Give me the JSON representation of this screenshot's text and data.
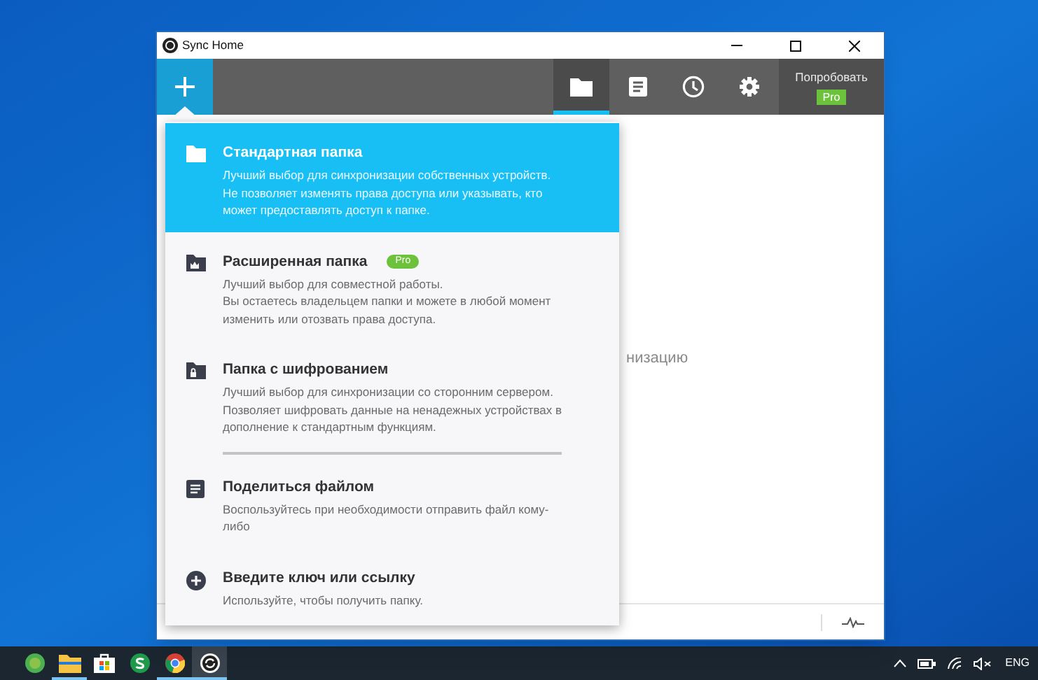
{
  "window": {
    "title": "Sync Home"
  },
  "toolbar": {
    "tabs": [
      {
        "kind": "folder",
        "selected": true
      },
      {
        "kind": "list",
        "selected": false
      },
      {
        "kind": "clock",
        "selected": false
      },
      {
        "kind": "gear",
        "selected": false
      }
    ],
    "try_label": "Попробовать",
    "pro_badge": "Pro"
  },
  "add_menu": {
    "items": [
      {
        "kind": "folder",
        "title": "Стандартная папка",
        "description": "Лучший выбор для синхронизации собственных устройств.\nНе позволяет изменять права доступа или указывать, кто\nможет предоставлять доступ к папке.",
        "selected": true,
        "separator_after": false
      },
      {
        "kind": "crown-folder",
        "title": "Расширенная папка",
        "badge": "Pro",
        "description": "Лучший выбор для совместной работы.\nВы остаетесь владельцем папки и можете в любой момент\nизменить или отозвать права доступа.",
        "selected": false,
        "separator_after": false
      },
      {
        "kind": "lock-folder",
        "title": "Папка с шифрованием",
        "description": "Лучший выбор для синхронизации со сторонним сервером.\nПозволяет шифровать данные на ненадежных устройствах в\nдополнение к стандартным функциям.",
        "selected": false,
        "separator_after": true
      },
      {
        "kind": "file",
        "title": "Поделиться файлом",
        "description": "Воспользуйтесь при необходимости отправить файл кому-\nлибо",
        "selected": false,
        "separator_after": false
      },
      {
        "kind": "plus",
        "title": "Введите ключ или ссылку",
        "description": "Используйте, чтобы получить папку.",
        "selected": false,
        "separator_after": false
      }
    ]
  },
  "background_text": "низацию",
  "taskbar": {
    "apps": [
      {
        "kind": "green-ball",
        "running": false,
        "selected": false
      },
      {
        "kind": "explorer",
        "running": true,
        "selected": false
      },
      {
        "kind": "store",
        "running": false,
        "selected": false
      },
      {
        "kind": "s-app",
        "running": false,
        "selected": false
      },
      {
        "kind": "chrome",
        "running": true,
        "selected": false
      },
      {
        "kind": "sync",
        "running": true,
        "selected": true
      }
    ],
    "language": "ENG"
  }
}
